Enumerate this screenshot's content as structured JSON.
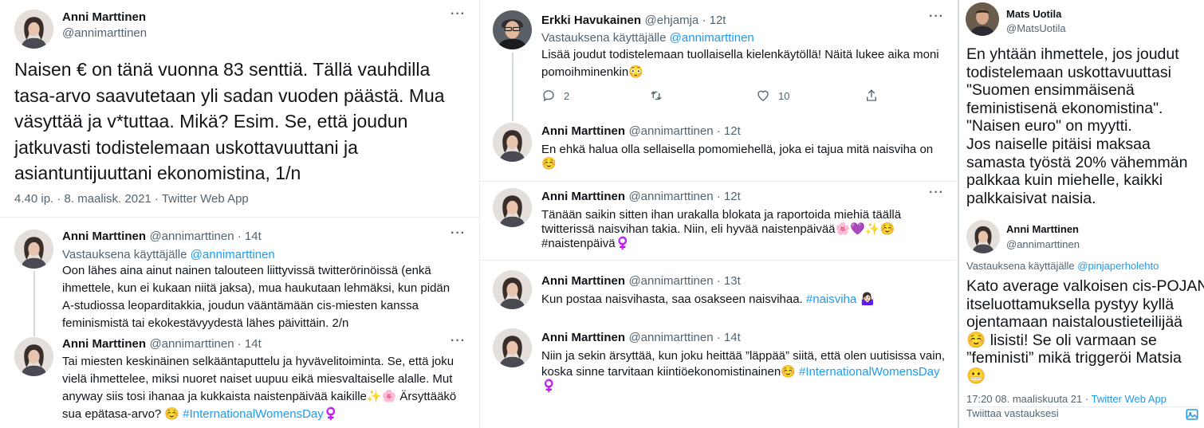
{
  "col1": {
    "main_tweet": {
      "name": "Anni Marttinen",
      "handle": "@annimarttinen",
      "lines": [
        "Naisen € on tänä vuonna 83 senttiä. Tällä vauhdilla",
        "tasa-arvo saavutetaan yli sadan vuoden päästä. Mua",
        "väsyttää ja v*tuttaa. Mikä? Esim. Se, että joudun",
        "jatkuvasti todistelemaan uskottavuuttani ja",
        "asiantuntijuuttani ekonomistina, 1/n"
      ],
      "timestamp": "4.40 ip. · 8. maalisk. 2021 · Twitter Web App"
    },
    "reply1": {
      "name": "Anni Marttinen",
      "handle": "@annimarttinen · 14t",
      "reply_prefix": "Vastauksena käyttäjälle",
      "reply_to": "@annimarttinen",
      "lines": [
        "Oon lähes aina ainut nainen talouteen liittyvissä twitterörinöissä (enkä",
        "ihmettele, kun ei kukaan niitä jaksa), mua haukutaan lehmäksi, kun pidän",
        "A-studiossa leoparditakkia, joudun vääntämään cis-miesten kanssa",
        "feminismistä tai ekokestävyydestä lähes päivittäin. 2/n"
      ]
    },
    "reply2": {
      "name": "Anni Marttinen",
      "handle": "@annimarttinen · 14t",
      "lines": [
        "Tai miesten keskinäinen selkääntaputtelu ja hyvävelitoiminta. Se, että joku",
        "vielä ihmettelee, miksi nuoret naiset uupuu eikä miesvaltaiselle alalle. Mut",
        "anyway siis tosi ihanaa ja kukkaista naistenpäivää kaikille✨🌸 Ärsyttääkö"
      ],
      "last_plain": "sua epätasa-arvo? ☺️ ",
      "last_tag": "#InternationalWomensDay♀️"
    }
  },
  "col2": {
    "t1": {
      "name": "Erkki Havukainen",
      "handle": "@ehjamja · 12t",
      "reply_prefix": "Vastauksena käyttäjälle",
      "reply_to": "@annimarttinen",
      "lines": [
        "Lisää joudut todistelemaan tuollaisella kielenkäytöllä! Näitä lukee aika moni",
        "pomoihminenkin😳"
      ],
      "replies": "2",
      "likes": "10"
    },
    "t2": {
      "name": "Anni Marttinen",
      "handle": "@annimarttinen · 12t",
      "lines": [
        "En ehkä halua olla sellaisella pomomiehellä, joka ei tajua mitä naisviha on",
        "☺️"
      ]
    },
    "t3": {
      "name": "Anni Marttinen",
      "handle": "@annimarttinen · 12t",
      "lines": [
        "Tänään saikin sitten ihan urakalla blokata ja raportoida miehiä täällä",
        "twitterissä naisvihan takia. Niin, eli hyvää naistenpäivää🌸💜✨☺️"
      ],
      "tag_line": "#naistenpäivä♀️"
    },
    "t4": {
      "name": "Anni Marttinen",
      "handle": "@annimarttinen · 13t",
      "text_plain": "Kun postaa naisvihasta, saa osakseen naisvihaa. ",
      "text_tag": "#naisviha",
      "text_emoji": " 🤷🏻‍♀️"
    },
    "t5": {
      "name": "Anni Marttinen",
      "handle": "@annimarttinen · 14t",
      "line1": "Niin ja sekin ärsyttää, kun joku heittää ”läppää” siitä, että olen uutisissa vain,",
      "line2_plain": "koska sinne tarvitaan kiintiöekonomistinainen☺️ ",
      "line2_tag": "#InternationalWomensDay",
      "line3": "♀️"
    }
  },
  "col3": {
    "t1": {
      "name": "Mats Uotila",
      "handle": "@MatsUotila",
      "lines": [
        "En yhtään ihmettele, jos joudut",
        "todistelemaan uskottavuuttasi",
        "\"Suomen ensimmäisenä",
        "feministisenä ekonomistina\".",
        "\"Naisen euro\" on myytti.",
        "Jos naiselle pitäisi maksaa",
        "samasta työstä 20% vähemmän",
        "palkkaa kuin miehelle, kaikki",
        "palkkaisivat naisia."
      ]
    },
    "t2": {
      "name": "Anni Marttinen",
      "handle": "@annimarttinen",
      "reply_prefix": "Vastauksena käyttäjälle",
      "reply_to": "@pinjaperholehto",
      "lines": [
        "Kato average valkoisen cis-POJAN",
        "itseluottamuksella pystyy kyllä",
        "ojentamaan naistaloustieteilijää",
        "☺️ lisisti! Se oli varmaan se",
        "”feministi” mikä triggeröi Matsia",
        "😬"
      ],
      "timestamp": "17:20 08. maaliskuuta 21 · ",
      "app": "Twitter Web App",
      "reply_box": "Twiittaa vastauksesi"
    }
  },
  "colors": {
    "link": "#1d9bf0",
    "muted": "#536471",
    "text": "#0f1419",
    "divider": "#e6ecf0"
  }
}
